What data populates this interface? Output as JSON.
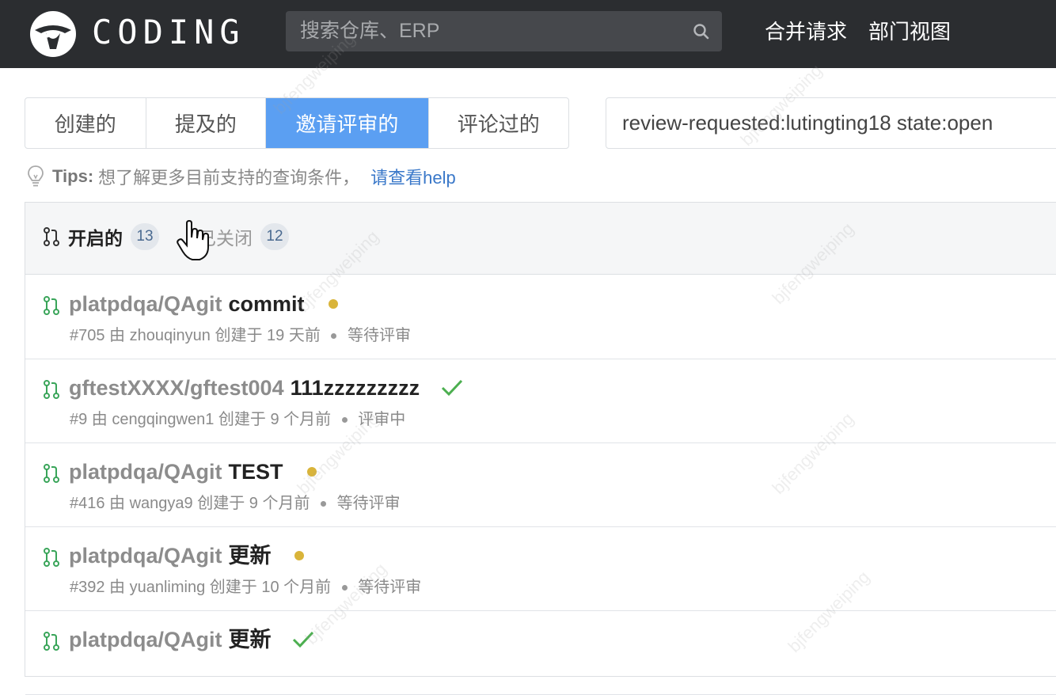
{
  "header": {
    "logo_text": "CODING",
    "search_placeholder": "搜索仓库、ERP",
    "nav": [
      "合并请求",
      "部门视图"
    ]
  },
  "filter": {
    "tabs": [
      {
        "label": "创建的",
        "active": false
      },
      {
        "label": "提及的",
        "active": false
      },
      {
        "label": "邀请评审的",
        "active": true
      },
      {
        "label": "评论过的",
        "active": false
      }
    ],
    "query_value": "review-requested:lutingting18 state:open"
  },
  "tips": {
    "label": "Tips:",
    "text": "想了解更多目前支持的查询条件，",
    "link": "请查看help"
  },
  "states": {
    "open_label": "开启的",
    "open_count": "13",
    "closed_label": "已关闭",
    "closed_count": "12"
  },
  "merge_requests": [
    {
      "repo": "platpdqa/QAgit",
      "title": "commit",
      "status": "pending",
      "meta_left": "#705 由 zhouqinyun 创建于 19 天前",
      "meta_right": "等待评审"
    },
    {
      "repo": "gftestXXXX/gftest004",
      "title": "111zzzzzzzzz",
      "status": "approved",
      "meta_left": "#9 由 cengqingwen1 创建于 9 个月前",
      "meta_right": "评审中"
    },
    {
      "repo": "platpdqa/QAgit",
      "title": "TEST",
      "status": "pending",
      "meta_left": "#416 由 wangya9 创建于 9 个月前",
      "meta_right": "等待评审"
    },
    {
      "repo": "platpdqa/QAgit",
      "title": "更新",
      "status": "pending",
      "meta_left": "#392 由 yuanliming 创建于 10 个月前",
      "meta_right": "等待评审"
    },
    {
      "repo": "platpdqa/QAgit",
      "title": "更新",
      "status": "approved",
      "meta_left": "",
      "meta_right": ""
    }
  ],
  "watermark_text": "bjfengweiping",
  "colors": {
    "topbar": "#2b2d30",
    "active_tab": "#5b9ff2",
    "pending_dot": "#d9b43a",
    "approved_check": "#4caf50",
    "mr_icon": "#3aa55a",
    "link": "#3a78c9"
  }
}
